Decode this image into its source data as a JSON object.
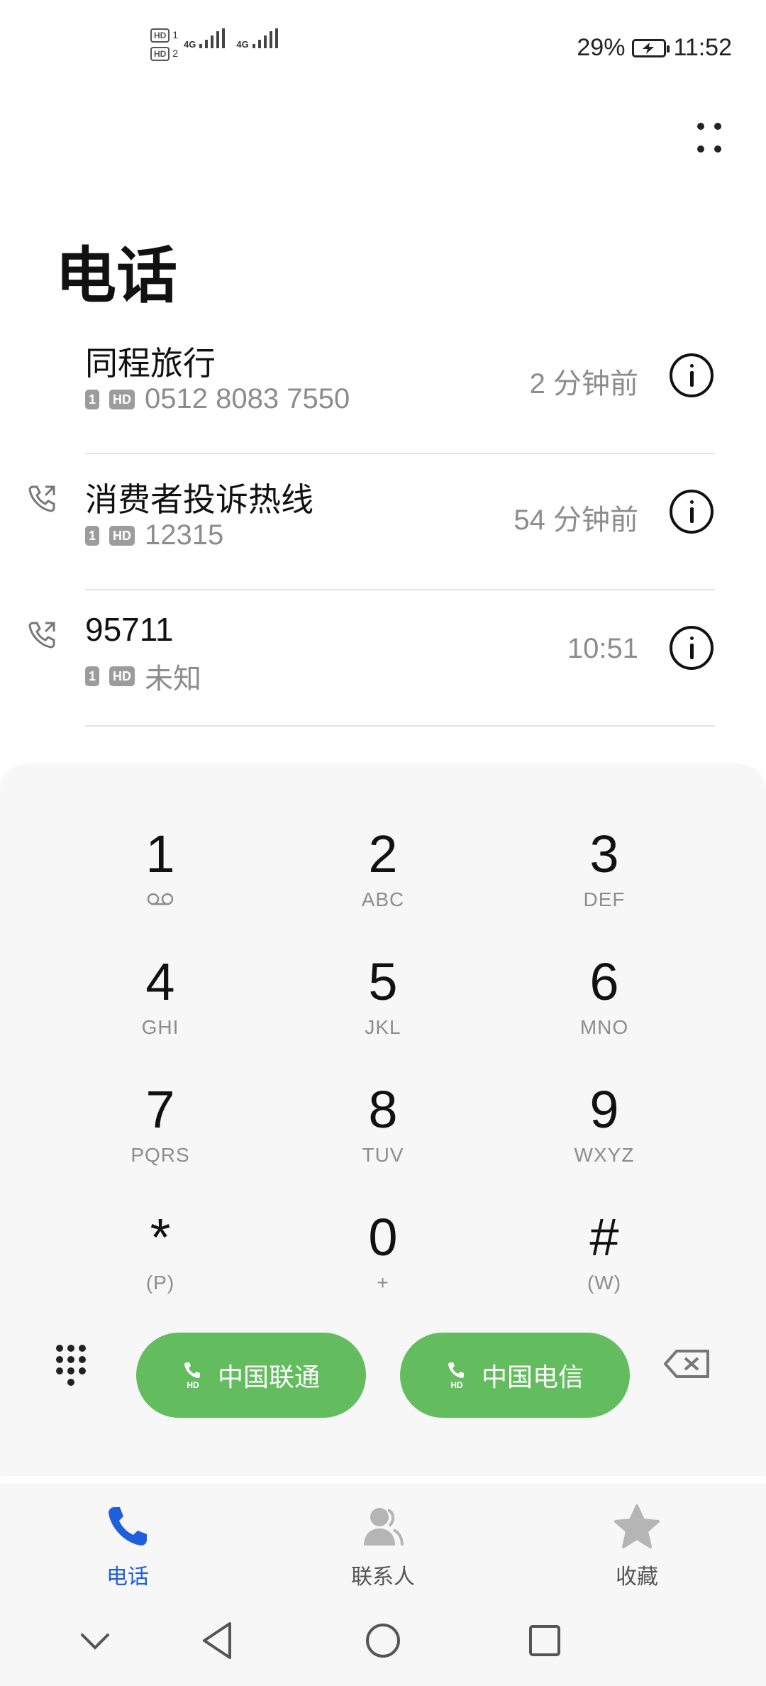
{
  "status_bar": {
    "battery": "29%",
    "time": "11:52",
    "sim1_hd": "HD",
    "sim1": "1",
    "sim2_hd": "HD",
    "sim2": "2",
    "network1": "4G",
    "network2": "4G"
  },
  "header": {
    "title": "电话"
  },
  "calls": [
    {
      "name": "同程旅行",
      "sim": "1",
      "hd": "HD",
      "number": "0512 8083 7550",
      "time": "2 分钟前",
      "outgoing": false
    },
    {
      "name": "消费者投诉热线",
      "sim": "1",
      "hd": "HD",
      "number": "12315",
      "time": "54 分钟前",
      "outgoing": true
    },
    {
      "name": "95711",
      "sim": "1",
      "hd": "HD",
      "number": "未知",
      "time": "10:51",
      "outgoing": true
    }
  ],
  "dialpad": {
    "keys": [
      {
        "digit": "1",
        "letters": ""
      },
      {
        "digit": "2",
        "letters": "ABC"
      },
      {
        "digit": "3",
        "letters": "DEF"
      },
      {
        "digit": "4",
        "letters": "GHI"
      },
      {
        "digit": "5",
        "letters": "JKL"
      },
      {
        "digit": "6",
        "letters": "MNO"
      },
      {
        "digit": "7",
        "letters": "PQRS"
      },
      {
        "digit": "8",
        "letters": "TUV"
      },
      {
        "digit": "9",
        "letters": "WXYZ"
      },
      {
        "digit": "*",
        "letters": "(P)"
      },
      {
        "digit": "0",
        "letters": "+"
      },
      {
        "digit": "#",
        "letters": "(W)"
      }
    ],
    "call_sim1": {
      "label": "中国联通",
      "sim": "1",
      "hd": "HD"
    },
    "call_sim2": {
      "label": "中国电信",
      "sim": "2",
      "hd": "HD"
    }
  },
  "bottom_nav": {
    "items": [
      {
        "label": "电话",
        "active": true
      },
      {
        "label": "联系人",
        "active": false
      },
      {
        "label": "收藏",
        "active": false
      }
    ]
  },
  "colors": {
    "accent_blue": "#1f5fdc",
    "call_green": "#63bd5f",
    "inactive_icon": "#b5b5b5"
  }
}
